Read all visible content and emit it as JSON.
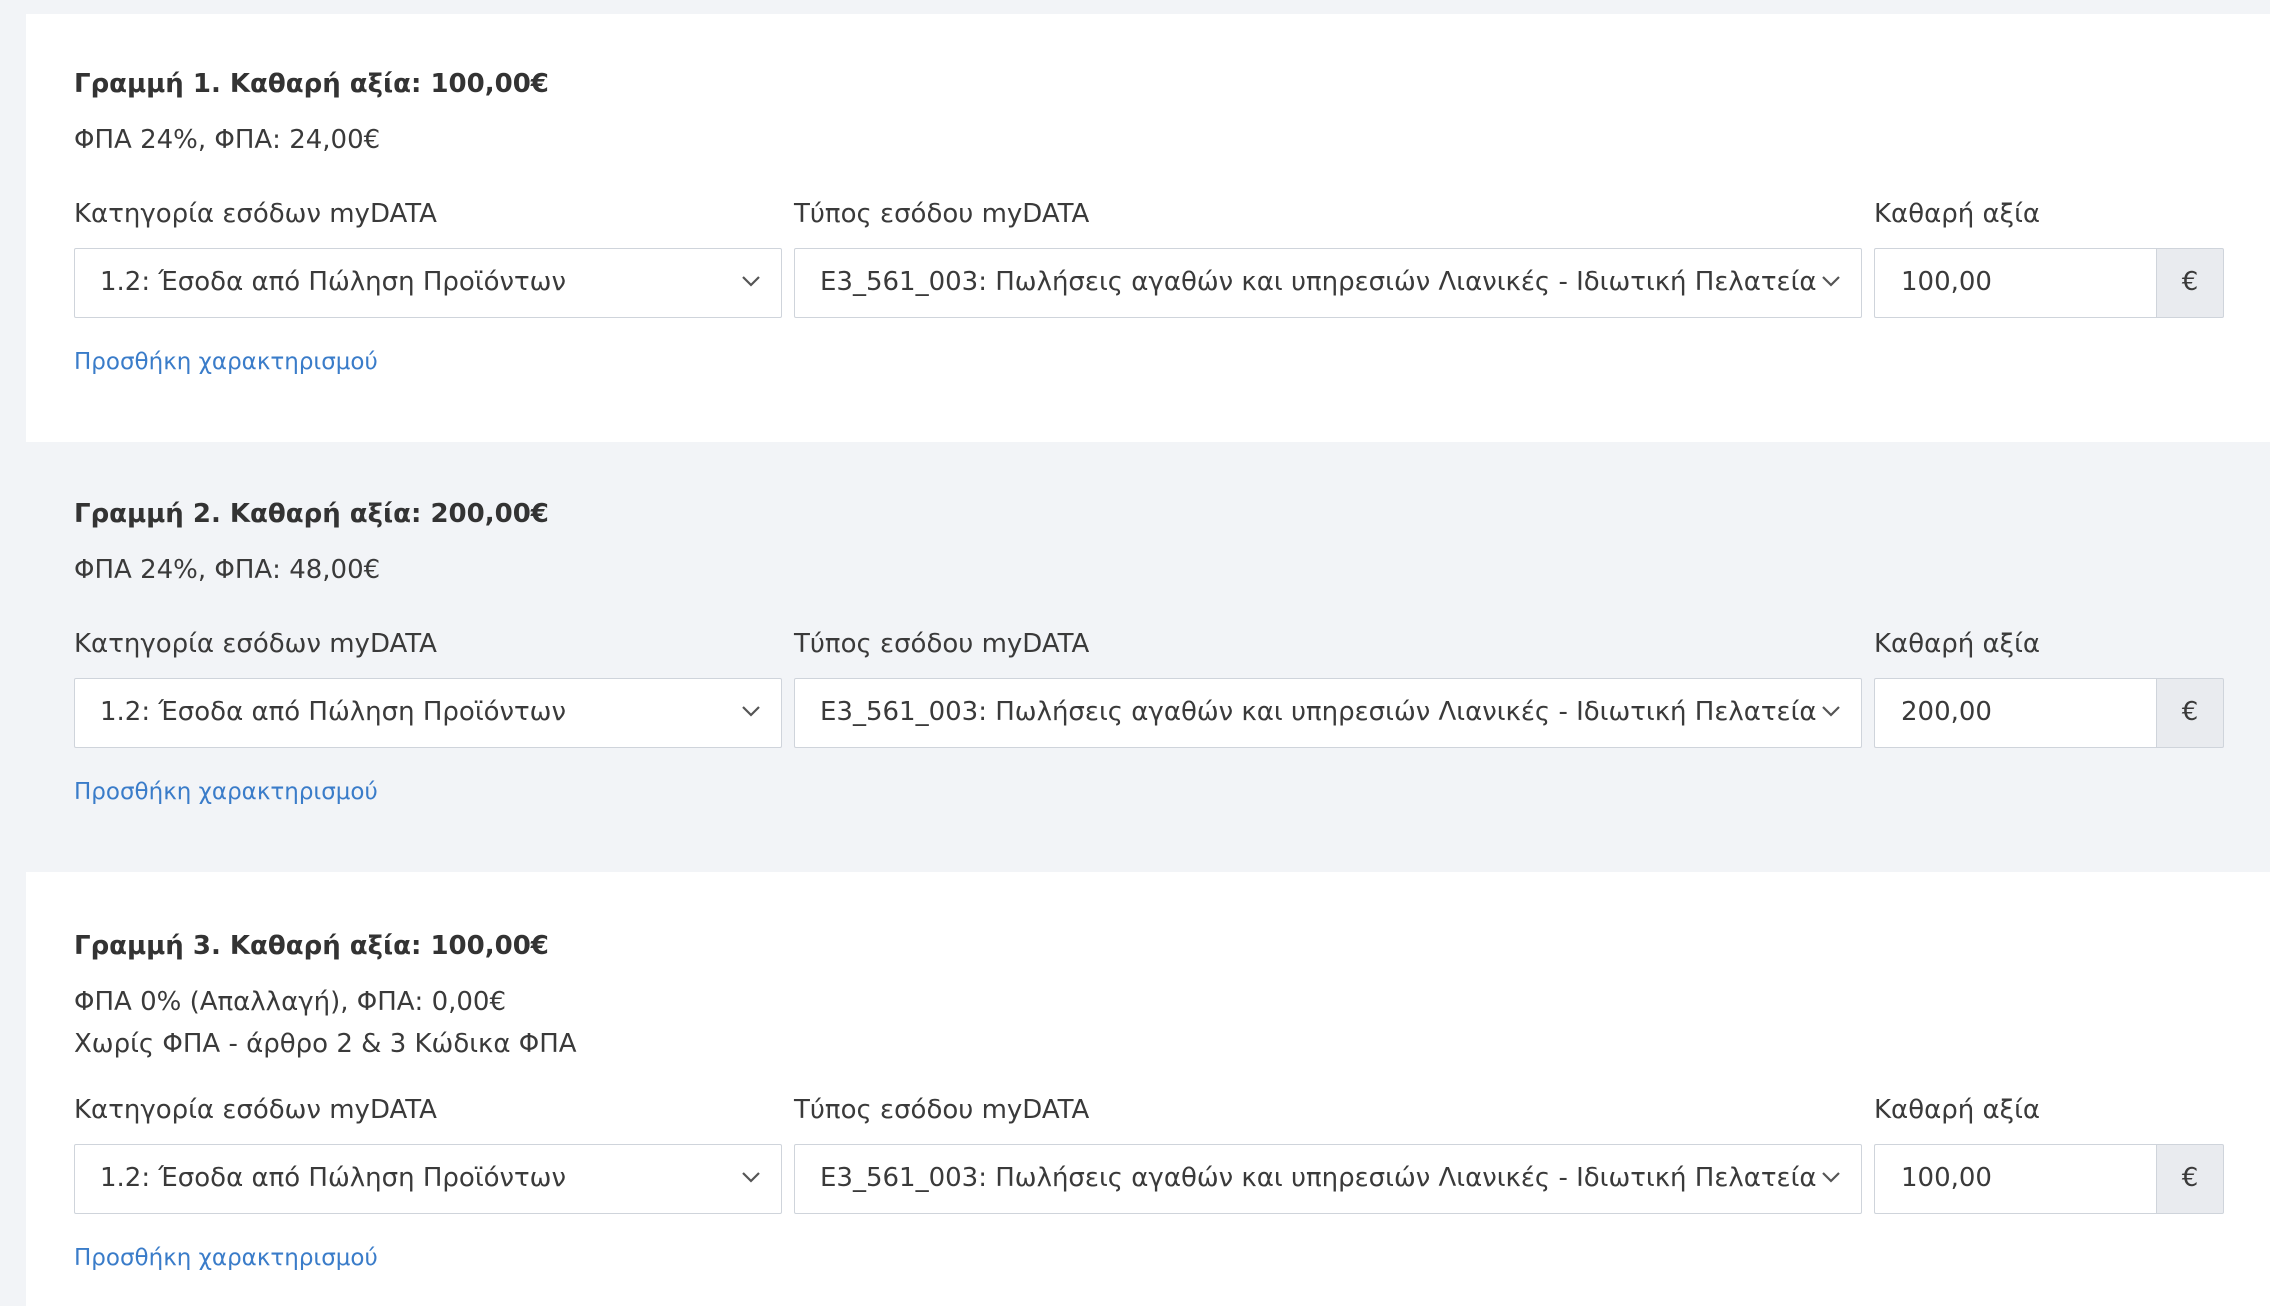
{
  "labels": {
    "category": "Κατηγορία εσόδων myDATA",
    "type": "Τύπος εσόδου myDATA",
    "net_value": "Καθαρή αξία"
  },
  "add_link": "Προσθήκη χαρακτηρισμού",
  "currency": "€",
  "lines": [
    {
      "title": "Γραμμή 1. Καθαρή αξία: 100,00€",
      "vat": "ΦΠΑ 24%, ΦΠΑ: 24,00€",
      "category": "1.2: Έσοδα από Πώληση Προϊόντων",
      "type": "Ε3_561_003: Πωλήσεις αγαθών και υπηρεσιών Λιανικές - Ιδιωτική Πελατεία",
      "net_value": "100,00"
    },
    {
      "title": "Γραμμή 2. Καθαρή αξία: 200,00€",
      "vat": "ΦΠΑ 24%, ΦΠΑ: 48,00€",
      "category": "1.2: Έσοδα από Πώληση Προϊόντων",
      "type": "Ε3_561_003: Πωλήσεις αγαθών και υπηρεσιών Λιανικές - Ιδιωτική Πελατεία",
      "net_value": "200,00"
    },
    {
      "title": "Γραμμή 3. Καθαρή αξία: 100,00€",
      "vat": "ΦΠΑ 0% (Απαλλαγή), ΦΠΑ: 0,00€",
      "vat_note": "Χωρίς ΦΠΑ - άρθρο 2 & 3 Κώδικα ΦΠΑ",
      "category": "1.2: Έσοδα από Πώληση Προϊόντων",
      "type": "Ε3_561_003: Πωλήσεις αγαθών και υπηρεσιών Λιανικές - Ιδιωτική Πελατεία",
      "net_value": "100,00"
    }
  ]
}
